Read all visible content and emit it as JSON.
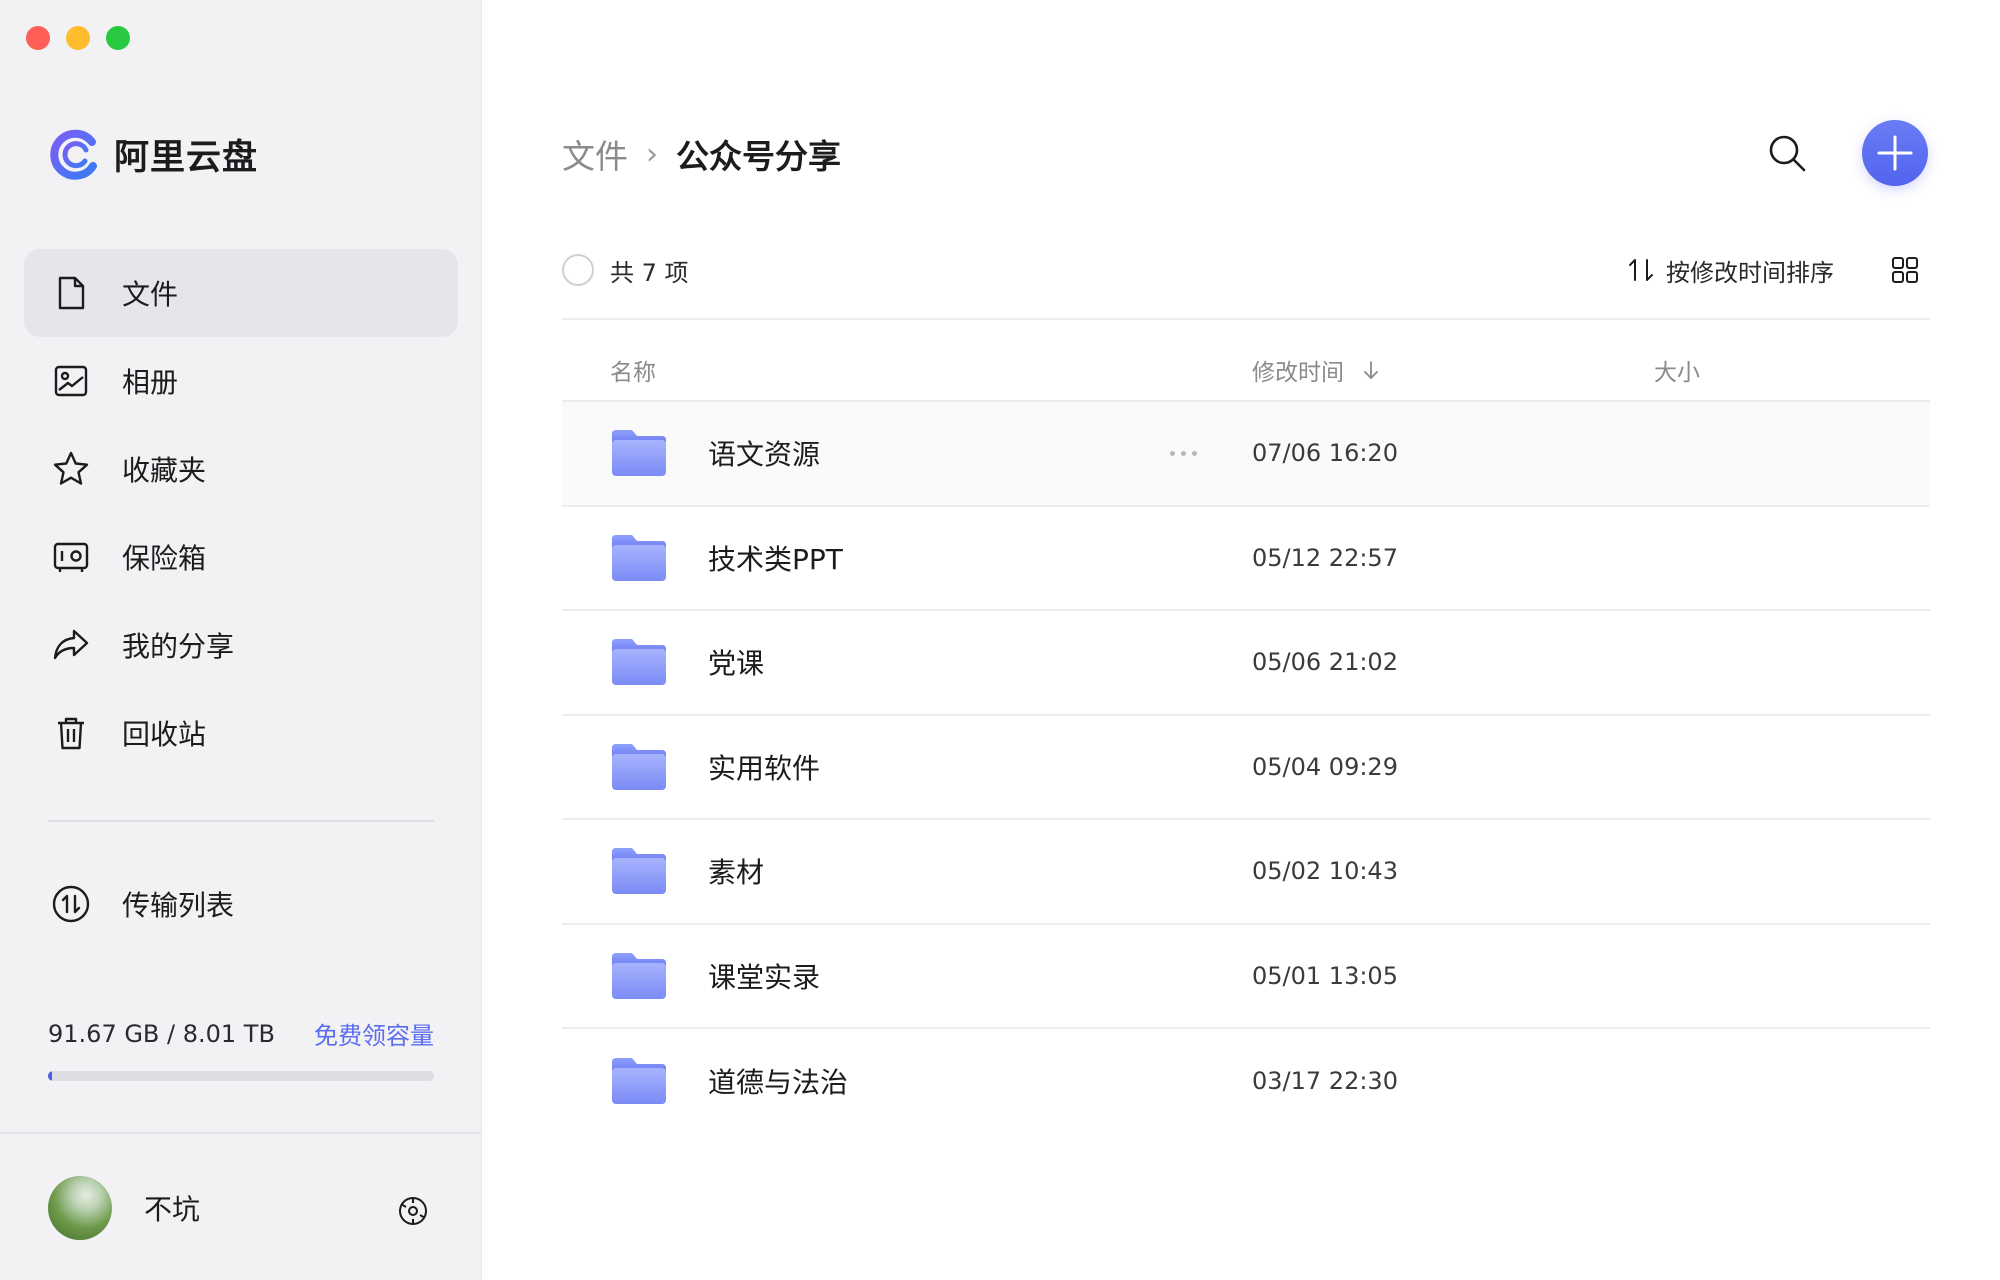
{
  "window": {
    "controls": [
      "close",
      "minimize",
      "maximize"
    ]
  },
  "brand": {
    "name": "阿里云盘",
    "accent_color": "#5264ee"
  },
  "sidebar": {
    "items": [
      {
        "label": "文件",
        "icon": "file-icon",
        "active": true
      },
      {
        "label": "相册",
        "icon": "photo-album-icon",
        "active": false
      },
      {
        "label": "收藏夹",
        "icon": "star-icon",
        "active": false
      },
      {
        "label": "保险箱",
        "icon": "safe-icon",
        "active": false
      },
      {
        "label": "我的分享",
        "icon": "share-icon",
        "active": false
      },
      {
        "label": "回收站",
        "icon": "trash-icon",
        "active": false
      }
    ],
    "transfer": {
      "label": "传输列表",
      "icon": "transfer-icon"
    },
    "storage": {
      "usage_text": "91.67 GB / 8.01 TB",
      "link_label": "免费领容量",
      "used_fraction": 0.011
    },
    "user": {
      "name": "不坑",
      "settings_icon": "settings-icon"
    }
  },
  "header": {
    "breadcrumb_root": "文件",
    "breadcrumb_separator": "›",
    "breadcrumb_current": "公众号分享",
    "search_icon": "search-icon",
    "add_icon": "plus-icon"
  },
  "toolbar": {
    "count_label": "共 7 项",
    "sort_label": "按修改时间排序",
    "sort_icon": "sort-arrows-icon",
    "view_icon": "grid-view-icon"
  },
  "table": {
    "columns": {
      "name": "名称",
      "modified": "修改时间",
      "size": "大小"
    },
    "rows": [
      {
        "name": "语文资源",
        "modified": "07/06 16:20",
        "size": "",
        "hover": true
      },
      {
        "name": "技术类PPT",
        "modified": "05/12 22:57",
        "size": "",
        "hover": false
      },
      {
        "name": "党课",
        "modified": "05/06 21:02",
        "size": "",
        "hover": false
      },
      {
        "name": "实用软件",
        "modified": "05/04 09:29",
        "size": "",
        "hover": false
      },
      {
        "name": "素材",
        "modified": "05/02 10:43",
        "size": "",
        "hover": false
      },
      {
        "name": "课堂实录",
        "modified": "05/01 13:05",
        "size": "",
        "hover": false
      },
      {
        "name": "道德与法治",
        "modified": "03/17 22:30",
        "size": "",
        "hover": false
      }
    ]
  }
}
